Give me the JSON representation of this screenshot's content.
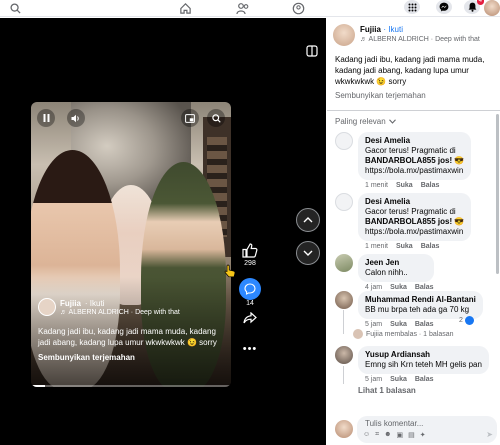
{
  "colors": {
    "accent": "#1877f2",
    "notification": "#e41e3f",
    "stage_bg": "#000000",
    "bubble": "#f0f2f5"
  },
  "topbar": {
    "icons": [
      "search-icon",
      "home-icon",
      "friends-icon",
      "groups-icon",
      "menu-grid-icon",
      "messenger-icon",
      "bell-icon",
      "avatar"
    ],
    "notification_count": "4"
  },
  "reel": {
    "author": "Fujiia",
    "follow": "· Ikuti",
    "music": "♬ ALBERN ALDRICH · Deep with that",
    "caption": "Kadang jadi ibu, kadang jadi mama muda, kadang jadi abang, kadang lupa umur wkwkwkwk 😉 sorry",
    "hide_translation": "Sembunyikan terjemahan",
    "likes": "298",
    "comments": "14",
    "progress": 0.07
  },
  "post": {
    "author": "Fujiia",
    "follow": "· Ikuti",
    "music": "♬ ALBERN ALDRICH · Deep with that",
    "caption": "Kadang jadi ibu, kadang jadi mama muda, kadang jadi abang, kadang lupa umur wkwkwkwk 😉 sorry",
    "hide_translation": "Sembunyikan terjemahan"
  },
  "comments": {
    "sort_label": "Paling relevan",
    "items": [
      {
        "name": "Desi Amelia",
        "line1": "Gacor terus! Pragmatic di",
        "line2": "BANDARBOLA855 jos! 😎",
        "line3": "https://bola.mx/pastimaxwin",
        "time": "1 menit",
        "like": "Suka",
        "reply": "Balas"
      },
      {
        "name": "Desi Amelia",
        "line1": "Gacor terus! Pragmatic di",
        "line2": "BANDARBOLA855 jos! 😎",
        "line3": "https://bola.mx/pastimaxwin",
        "time": "1 menit",
        "like": "Suka",
        "reply": "Balas"
      },
      {
        "name": "Jeen Jen",
        "line1": "Calon nihh..",
        "time": "4 jam",
        "like": "Suka",
        "reply": "Balas"
      },
      {
        "name": "Muhammad Rendi Al-Bantani",
        "line1": "BB mu brpa teh ada ga 70 kg",
        "time": "5 jam",
        "like": "Suka",
        "reply": "Balas",
        "reply_summary": "Fujiia membalas · 1 balasan",
        "reply_count": "2"
      },
      {
        "name": "Yusup Ardiansah",
        "line1": "Emng sih Krn teteh MH gelis pan",
        "time": "5 jam",
        "like": "Suka",
        "reply": "Balas",
        "more_replies": "Lihat 1 balasan"
      }
    ]
  },
  "composer": {
    "placeholder": "Tulis komentar..."
  }
}
